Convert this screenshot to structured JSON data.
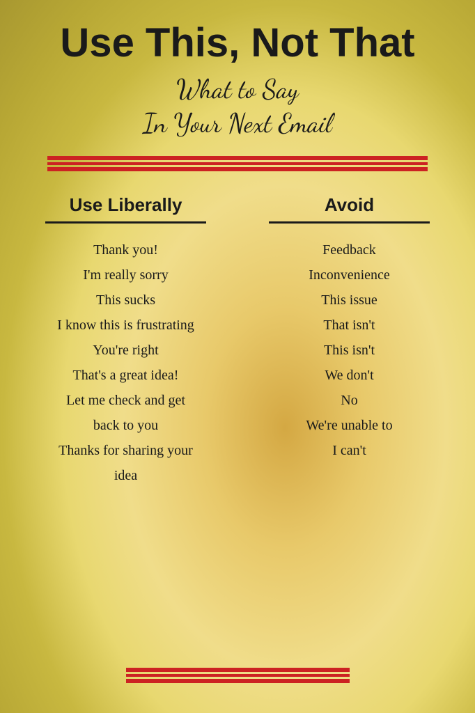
{
  "header": {
    "main_title": "Use This, Not That",
    "subtitle_line1": "What to Say",
    "subtitle_line2": "In Your Next Email"
  },
  "use_column": {
    "header": "Use Liberally",
    "items": [
      "Thank you!",
      "I'm really sorry",
      "This sucks",
      "I know this is frustrating",
      "You're right",
      "That's a great idea!",
      "Let me check and get",
      "back to you",
      "Thanks for sharing your",
      "idea"
    ]
  },
  "avoid_column": {
    "header": "Avoid",
    "items": [
      "Feedback",
      "Inconvenience",
      "This issue",
      "That isn't",
      "This isn't",
      "We don't",
      "No",
      "We're unable to",
      "I can't"
    ]
  }
}
